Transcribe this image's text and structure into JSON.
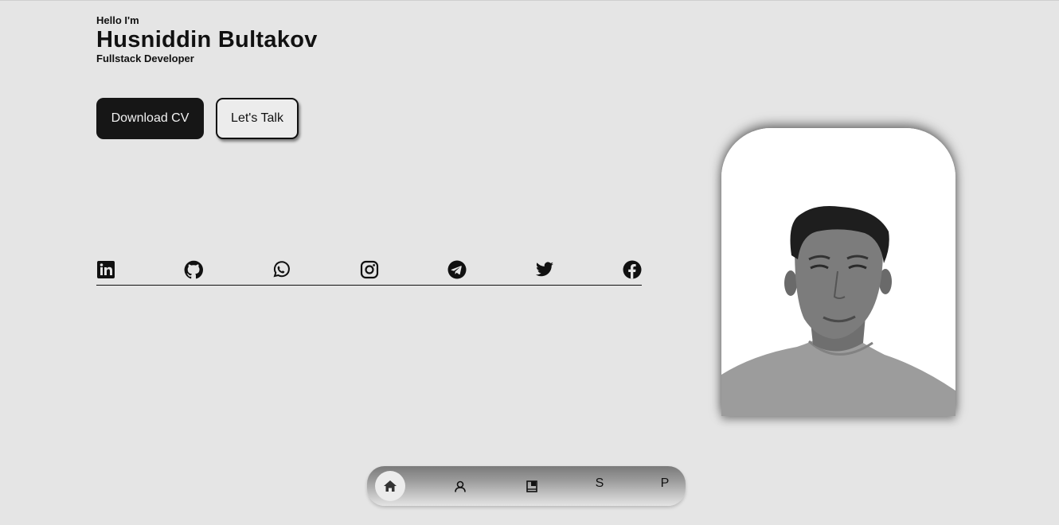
{
  "hero": {
    "greeting": "Hello I'm",
    "name": "Husniddin Bultakov",
    "role": "Fullstack Developer"
  },
  "buttons": {
    "download_cv": "Download CV",
    "lets_talk": "Let's Talk"
  },
  "socials": [
    "linkedin-icon",
    "github-icon",
    "whatsapp-icon",
    "instagram-icon",
    "telegram-icon",
    "twitter-icon",
    "facebook-icon"
  ],
  "nav": {
    "items": [
      {
        "icon": "home-icon",
        "active": true
      },
      {
        "icon": "user-icon"
      },
      {
        "icon": "book-icon"
      },
      {
        "label": "S"
      },
      {
        "label": "P"
      }
    ]
  },
  "colors": {
    "background": "#e5e5e5",
    "primary_dark": "#161616",
    "photo_bg": "#ffffff"
  }
}
